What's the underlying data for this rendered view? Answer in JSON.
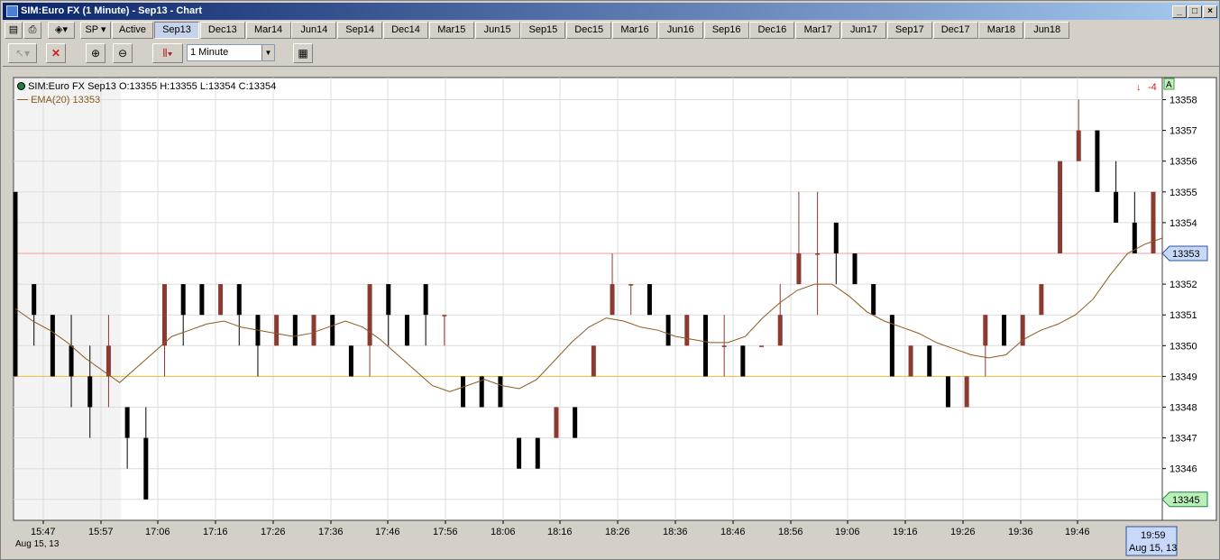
{
  "window": {
    "title": "SIM:Euro FX (1 Minute) - Sep13 - Chart"
  },
  "toolbar": {
    "instrument_label": "SP",
    "active_label": "Active",
    "tabs": [
      "Sep13",
      "Dec13",
      "Mar14",
      "Jun14",
      "Sep14",
      "Dec14",
      "Mar15",
      "Jun15",
      "Sep15",
      "Dec15",
      "Mar16",
      "Jun16",
      "Sep16",
      "Dec16",
      "Mar17",
      "Jun17",
      "Sep17",
      "Dec17",
      "Mar18",
      "Jun18"
    ],
    "active_tab": "Sep13",
    "interval": "1 Minute"
  },
  "legend": {
    "instrument": "SIM:Euro FX Sep13 O:13355 H:13355 L:13354 C:13354",
    "indicator": "EMA(20)  13353"
  },
  "status": {
    "position_arrow": "↓",
    "position_value": "-4",
    "price_axis_mode": "A"
  },
  "price_axis": {
    "ticks": [
      "13358",
      "13357",
      "13356",
      "13355",
      "13354",
      "13353",
      "13352",
      "13351",
      "13350",
      "13349",
      "13348",
      "13347",
      "13346",
      "13345"
    ],
    "last_price_label": "13353",
    "low_label": "13345"
  },
  "time_axis": {
    "ticks": [
      "15:47",
      "15:57",
      "17:06",
      "17:16",
      "17:26",
      "17:36",
      "17:46",
      "17:56",
      "18:06",
      "18:16",
      "18:26",
      "18:36",
      "18:46",
      "18:56",
      "19:06",
      "19:16",
      "19:26",
      "19:36",
      "19:46"
    ],
    "date_label": "Aug 15, 13",
    "cursor_time": "19:59",
    "cursor_date": "Aug 15, 13"
  },
  "colors": {
    "up_bar": "#8b3a32",
    "down_bar": "#000000",
    "ema_line": "#8b5a1e",
    "horizontal_line": "#e8c040",
    "last_price_line": "#e8a0a0",
    "price_label_bg": "#c8d8f8",
    "low_label_bg": "#b8f0b8"
  },
  "chart_data": {
    "type": "ohlc-bars",
    "series": [
      {
        "name": "EMA(20)",
        "values": [
          13351.2,
          13350.8,
          13350.5,
          13350.1,
          13349.6,
          13349.2,
          13348.8,
          13349.3,
          13349.8,
          13350.3,
          13350.5,
          13350.7,
          13350.8,
          13350.6,
          13350.5,
          13350.4,
          13350.3,
          13350.4,
          13350.6,
          13350.8,
          13350.6,
          13350.2,
          13349.7,
          13349.2,
          13348.7,
          13348.5,
          13348.7,
          13348.9,
          13348.7,
          13348.6,
          13348.9,
          13349.5,
          13350.1,
          13350.6,
          13350.9,
          13350.8,
          13350.6,
          13350.5,
          13350.3,
          13350.2,
          13350.1,
          13350.1,
          13350.3,
          13350.9,
          13351.4,
          13351.8,
          13352.0,
          13352.0,
          13351.6,
          13351.1,
          13350.8,
          13350.6,
          13350.4,
          13350.1,
          13349.9,
          13349.7,
          13349.6,
          13349.7,
          13350.2,
          13350.5,
          13350.7,
          13351.0,
          13351.5,
          13352.3,
          13353.0,
          13353.3,
          13353.5
        ]
      }
    ],
    "bars": [
      [
        13355,
        13355,
        13349,
        13349
      ],
      [
        13352,
        13352,
        13350,
        13351
      ],
      [
        13351,
        13351,
        13349,
        13349
      ],
      [
        13350,
        13351,
        13348,
        13349
      ],
      [
        13349,
        13350,
        13347,
        13348
      ],
      [
        13349,
        13351,
        13348,
        13350
      ],
      [
        13348,
        13348,
        13346,
        13347
      ],
      [
        13347,
        13348,
        13345,
        13345
      ],
      [
        13350,
        13352,
        13349,
        13352
      ],
      [
        13352,
        13352,
        13350,
        13351
      ],
      [
        13352,
        13352,
        13351,
        13351
      ],
      [
        13351,
        13352,
        13351,
        13352
      ],
      [
        13352,
        13352,
        13350,
        13351
      ],
      [
        13351,
        13351,
        13349,
        13350
      ],
      [
        13350,
        13351,
        13350,
        13351
      ],
      [
        13351,
        13351,
        13350,
        13350
      ],
      [
        13350,
        13351,
        13350,
        13351
      ],
      [
        13351,
        13351,
        13350,
        13350
      ],
      [
        13350,
        13350,
        13349,
        13349
      ],
      [
        13350,
        13352,
        13349,
        13352
      ],
      [
        13352,
        13352,
        13350,
        13351
      ],
      [
        13351,
        13351,
        13350,
        13350
      ],
      [
        13352,
        13352,
        13350,
        13351
      ],
      [
        13351,
        13351,
        13350,
        13351
      ],
      [
        13349,
        13349,
        13348,
        13348
      ],
      [
        13349,
        13349,
        13348,
        13348
      ],
      [
        13349,
        13349,
        13348,
        13348
      ],
      [
        13347,
        13347,
        13346,
        13346
      ],
      [
        13347,
        13347,
        13346,
        13346
      ],
      [
        13347,
        13348,
        13347,
        13348
      ],
      [
        13348,
        13348,
        13347,
        13347
      ],
      [
        13349,
        13350,
        13349,
        13350
      ],
      [
        13351,
        13353,
        13351,
        13352
      ],
      [
        13352,
        13352,
        13351,
        13352
      ],
      [
        13352,
        13352,
        13351,
        13351
      ],
      [
        13351,
        13351,
        13350,
        13350
      ],
      [
        13350,
        13351,
        13350,
        13351
      ],
      [
        13351,
        13351,
        13349,
        13349
      ],
      [
        13350,
        13351,
        13349,
        13350
      ],
      [
        13350,
        13350,
        13349,
        13349
      ],
      [
        13350,
        13350,
        13350,
        13350
      ],
      [
        13350,
        13352,
        13350,
        13351
      ],
      [
        13352,
        13355,
        13352,
        13353
      ],
      [
        13353,
        13355,
        13351,
        13353
      ],
      [
        13354,
        13354,
        13352,
        13353
      ],
      [
        13353,
        13353,
        13352,
        13352
      ],
      [
        13352,
        13352,
        13351,
        13351
      ],
      [
        13351,
        13351,
        13349,
        13349
      ],
      [
        13349,
        13350,
        13349,
        13350
      ],
      [
        13350,
        13350,
        13349,
        13349
      ],
      [
        13349,
        13349,
        13348,
        13348
      ],
      [
        13348,
        13349,
        13348,
        13349
      ],
      [
        13350,
        13351,
        13349,
        13351
      ],
      [
        13351,
        13351,
        13350,
        13350
      ],
      [
        13350,
        13351,
        13350,
        13351
      ],
      [
        13351,
        13352,
        13351,
        13352
      ],
      [
        13353,
        13355,
        13353,
        13356
      ],
      [
        13356,
        13358,
        13356,
        13357
      ],
      [
        13357,
        13357,
        13355,
        13355
      ],
      [
        13355,
        13356,
        13354,
        13354
      ],
      [
        13354,
        13355,
        13353,
        13353
      ],
      [
        13353,
        13355,
        13353,
        13355
      ]
    ]
  }
}
